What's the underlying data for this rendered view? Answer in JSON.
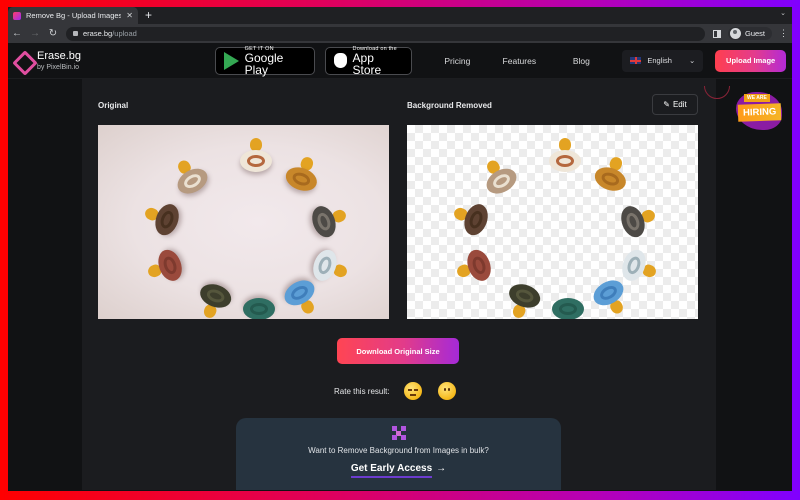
{
  "browser": {
    "tab_title": "Remove Bg - Upload Images to",
    "url_domain": "erase.bg",
    "url_path": "/upload",
    "profile_label": "Guest",
    "icons": {
      "back": "arrow-left-icon",
      "forward": "arrow-right-icon",
      "reload": "reload-icon",
      "lock": "lock-icon",
      "side_panel": "side-panel-icon",
      "menu": "kebab-menu-icon",
      "new_tab": "plus-icon",
      "close_tab": "close-icon"
    }
  },
  "header": {
    "logo_name": "Erase.bg",
    "logo_by": "by PixelBin.io",
    "google_play": {
      "small": "GET IT ON",
      "big": "Google Play"
    },
    "app_store": {
      "small": "Download on the",
      "big": "App Store"
    },
    "nav": [
      "Pricing",
      "Features",
      "Blog"
    ],
    "language": "English",
    "upload_label": "Upload Image"
  },
  "main": {
    "original_label": "Original",
    "removed_label": "Background Removed",
    "edit_label": "Edit",
    "download_label": "Download Original Size",
    "rate_label": "Rate this result:",
    "rating_options": [
      "sad-face",
      "neutral-face"
    ],
    "bulk": {
      "text": "Want to Remove Background from Images in bulk?",
      "cta": "Get Early Access",
      "cta_arrow": "→"
    },
    "hiring": {
      "top": "WE ARE",
      "main": "HIRING"
    }
  },
  "pacifiers": [
    {
      "shield": "#efe6d8",
      "accent": "#b5683e"
    },
    {
      "shield": "#c8872a",
      "accent": "#a86a1e"
    },
    {
      "shield": "#4d4a46",
      "accent": "#7a746c"
    },
    {
      "shield": "#dfe6ea",
      "accent": "#9db0b8"
    },
    {
      "shield": "#5c9ed6",
      "accent": "#3f7ebb"
    },
    {
      "shield": "#2f6e62",
      "accent": "#245a4f"
    },
    {
      "shield": "#3d3e2c",
      "accent": "#55563c"
    },
    {
      "shield": "#9a4a3c",
      "accent": "#7e3a2e"
    },
    {
      "shield": "#5e4232",
      "accent": "#47301f"
    },
    {
      "shield": "#b69a80",
      "accent": "#eae0d0"
    }
  ]
}
